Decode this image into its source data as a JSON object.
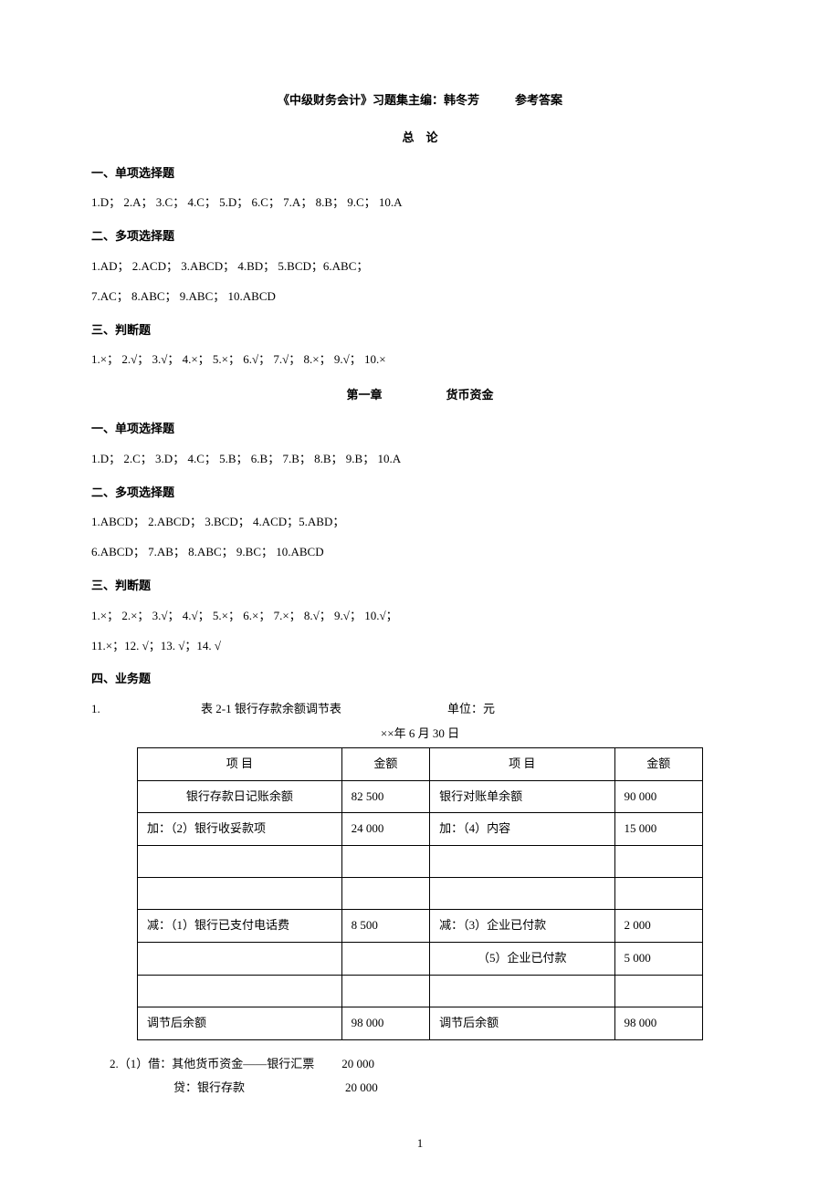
{
  "header": {
    "title_line": "《中级财务会计》习题集主编：韩冬芳　　　参考答案",
    "subtitle": "总　论"
  },
  "intro": {
    "s1_heading": "一、单项选择题",
    "s1_answers": "1.D；  2.A；  3.C；  4.C；  5.D；  6.C；  7.A；  8.B；  9.C；  10.A",
    "s2_heading": "二、多项选择题",
    "s2_line1": "1.AD；  2.ACD；  3.ABCD；  4.BD；  5.BCD；6.ABC；",
    "s2_line2": "7.AC；  8.ABC；  9.ABC；  10.ABCD",
    "s3_heading": "三、判断题",
    "s3_answers": "1.×；  2.√；  3.√；  4.×；  5.×；  6.√；  7.√；  8.×；  9.√；  10.×"
  },
  "chapter1": {
    "label": "第一章",
    "name": "货币资金",
    "s1_heading": "一、单项选择题",
    "s1_answers": "1.D；  2.C；  3.D；  4.C；  5.B；  6.B；  7.B；  8.B；  9.B；  10.A",
    "s2_heading": "二、多项选择题",
    "s2_line1": "1.ABCD；  2.ABCD；  3.BCD；  4.ACD；5.ABD；",
    "s2_line2": "6.ABCD；  7.AB；  8.ABC；  9.BC；  10.ABCD",
    "s3_heading": "三、判断题",
    "s3_line1": "1.×；  2.×；  3.√；  4.√；  5.×；  6.×；  7.×；  8.√；  9.√；  10.√；",
    "s3_line2": "11.×；12. √；13. √；14. √",
    "s4_heading": "四、业务题",
    "table_caption_num": "1.",
    "table_caption_title": "表 2-1    银行存款余额调节表",
    "table_caption_unit": "单位：元",
    "table_date": "××年 6 月 30 日",
    "table": {
      "h1": "项    目",
      "h2": "金额",
      "h3": "项    目",
      "h4": "金额",
      "r1c1": "银行存款日记账余额",
      "r1c2": "82 500",
      "r1c3": "银行对账单余额",
      "r1c4": "90 000",
      "r2c1": "加：（2）银行收妥款项",
      "r2c2": "24 000",
      "r2c3": "加：（4）内容",
      "r2c4": "15 000",
      "r3c1": "",
      "r3c2": "",
      "r3c3": "",
      "r3c4": "",
      "r4c1": "",
      "r4c2": "",
      "r4c3": "",
      "r4c4": "",
      "r5c1": "减：（1）银行已支付电话费",
      "r5c2": "8 500",
      "r5c3": "减：（3）企业已付款",
      "r5c4": "2 000",
      "r6c1": "",
      "r6c2": "",
      "r6c3": "（5）企业已付款",
      "r6c4": "5 000",
      "r7c1": "",
      "r7c2": "",
      "r7c3": "",
      "r7c4": "",
      "r8c1": "调节后余额",
      "r8c2": "98 000",
      "r8c3": "调节后余额",
      "r8c4": "98 000"
    },
    "entry1_debit_label": "2.（1）借：其他货币资金——银行汇票",
    "entry1_debit_amount": "20 000",
    "entry1_credit_label": "贷：银行存款",
    "entry1_credit_amount": "20 000"
  },
  "page_number": "1",
  "chart_data": {
    "type": "table",
    "title": "表 2-1 银行存款余额调节表",
    "unit": "元",
    "date": "××年6月30日",
    "left": {
      "label": "银行存款日记账余额",
      "opening": 82500,
      "adds": [
        {
          "item": "（2）银行收妥款项",
          "amount": 24000
        }
      ],
      "subs": [
        {
          "item": "（1）银行已支付电话费",
          "amount": 8500
        }
      ],
      "adjusted": 98000
    },
    "right": {
      "label": "银行对账单余额",
      "opening": 90000,
      "adds": [
        {
          "item": "（4）内容",
          "amount": 15000
        }
      ],
      "subs": [
        {
          "item": "（3）企业已付款",
          "amount": 2000
        },
        {
          "item": "（5）企业已付款",
          "amount": 5000
        }
      ],
      "adjusted": 98000
    }
  }
}
